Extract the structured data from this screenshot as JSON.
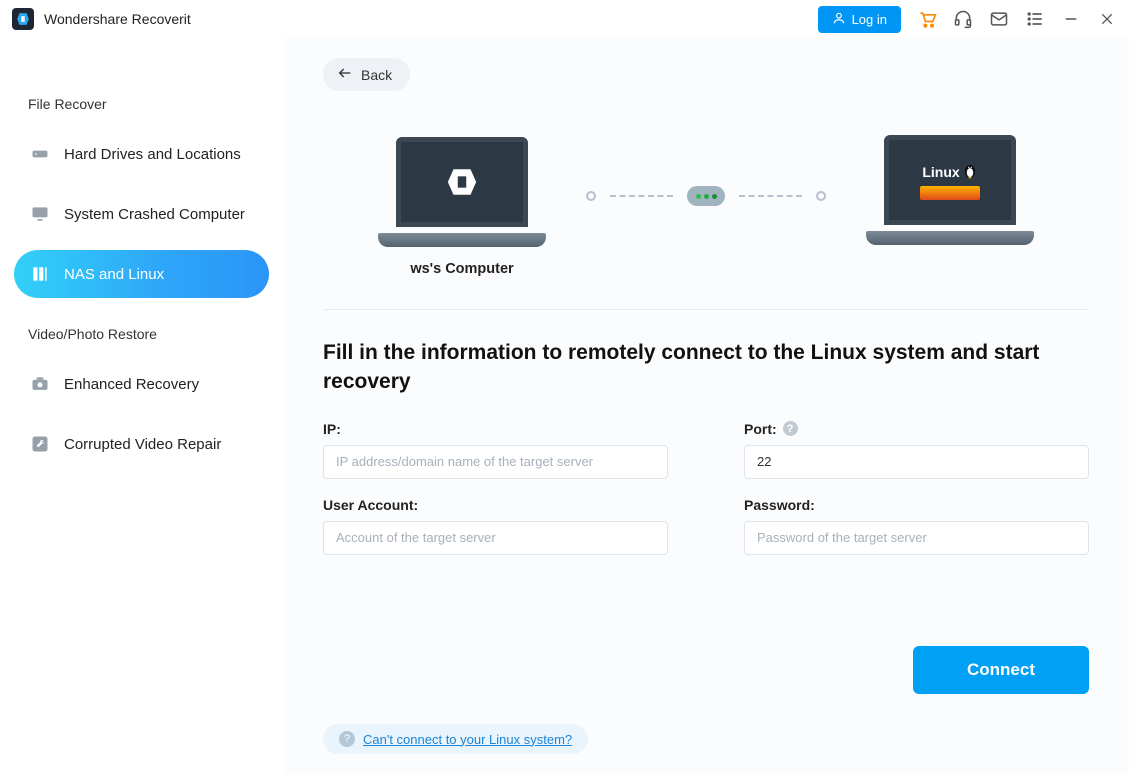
{
  "app": {
    "title": "Wondershare Recoverit"
  },
  "titlebar": {
    "login_label": "Log in"
  },
  "sidebar": {
    "section1_title": "File Recover",
    "section2_title": "Video/Photo Restore",
    "items": [
      {
        "label": "Hard Drives and Locations"
      },
      {
        "label": "System Crashed Computer"
      },
      {
        "label": "NAS and Linux"
      },
      {
        "label": "Enhanced Recovery"
      },
      {
        "label": "Corrupted Video Repair"
      }
    ]
  },
  "main": {
    "back_label": "Back",
    "local_pc_label": "ws's Computer",
    "linux_label": "Linux",
    "heading": "Fill in the information to remotely connect to the Linux system and start recovery",
    "form": {
      "ip_label": "IP:",
      "ip_placeholder": "IP address/domain name of the target server",
      "port_label": "Port:",
      "port_value": "22",
      "user_label": "User Account:",
      "user_placeholder": "Account of the target server",
      "password_label": "Password:",
      "password_placeholder": "Password of the target server"
    },
    "connect_label": "Connect",
    "help_link_label": "Can't connect to your Linux system?"
  }
}
